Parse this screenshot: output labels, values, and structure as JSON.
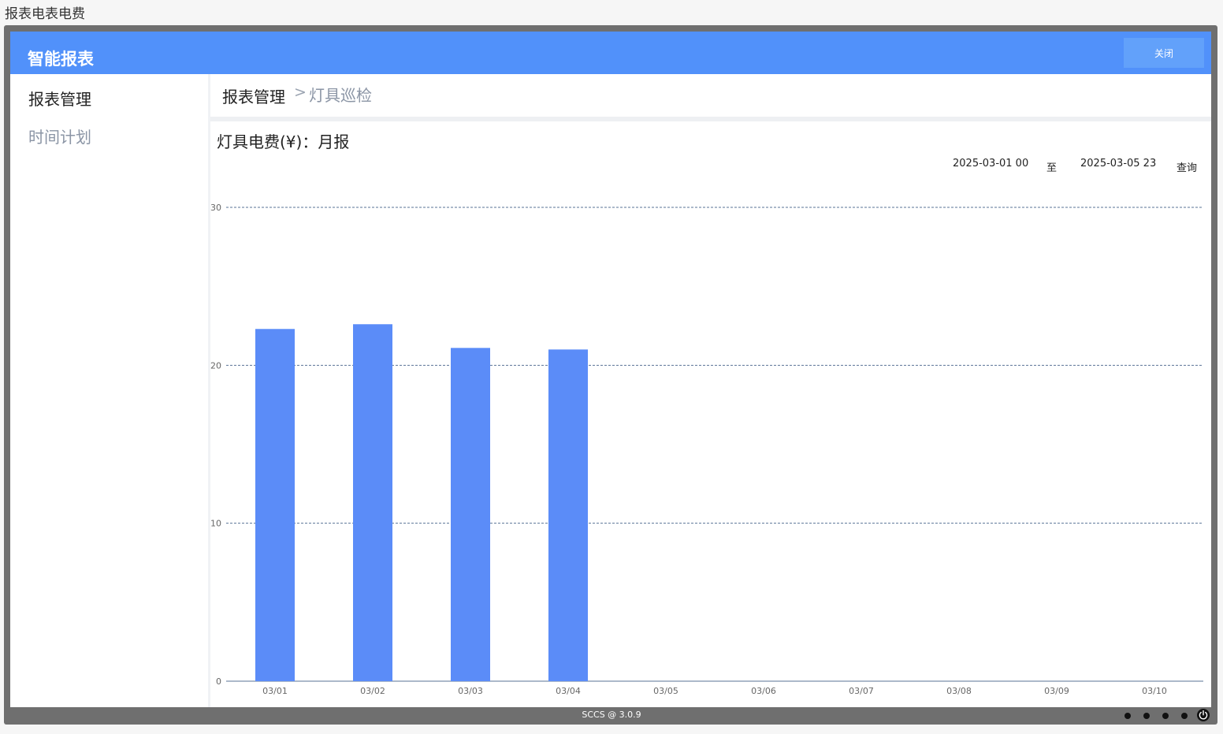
{
  "page_caption": "报表电表电费",
  "app": {
    "title": "智能报表",
    "close_label": "关闭"
  },
  "sidebar": {
    "items": [
      {
        "label": "报表管理",
        "active": true
      },
      {
        "label": "时间计划",
        "active": false
      }
    ]
  },
  "breadcrumb": {
    "home": "报表管理",
    "separator": ">",
    "current": "灯具巡检"
  },
  "report": {
    "title": "灯具电费(¥)：月报",
    "date_from": "2025-03-01 00",
    "to_label": "至",
    "date_to": "2025-03-05 23",
    "query_label": "查询"
  },
  "chart_data": {
    "type": "bar",
    "categories": [
      "03/01",
      "03/02",
      "03/03",
      "03/04",
      "03/05",
      "03/06",
      "03/07",
      "03/08",
      "03/09",
      "03/10"
    ],
    "values": [
      22.3,
      22.6,
      21.1,
      21.0,
      0,
      0,
      0,
      0,
      0,
      0
    ],
    "ylim": [
      0,
      30
    ],
    "yticks": [
      0,
      10,
      20,
      30
    ],
    "grid": true,
    "bar_color": "#5b8cf8",
    "grid_color": "#5a7396"
  },
  "footer": {
    "version": "SCCS @ 3.0.9",
    "dot_icons": [
      "dot-icon",
      "dot-icon",
      "dot-icon",
      "dot-icon"
    ],
    "power_icon": "power-icon"
  },
  "colors": {
    "titlebar": "#5191fa",
    "frame": "#6f6f6f"
  }
}
